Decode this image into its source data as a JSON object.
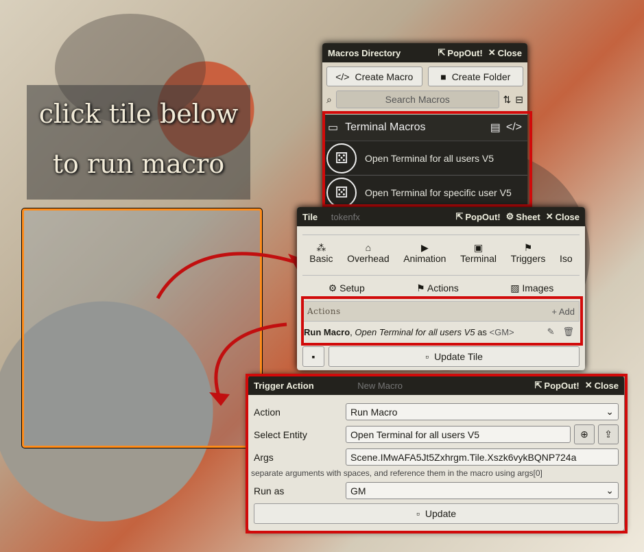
{
  "canvas": {
    "label_line1": "click tile below",
    "label_line2": "to run macro"
  },
  "macros_directory": {
    "title": "Macros Directory",
    "popout": "PopOut!",
    "close": "Close",
    "create_macro": "Create Macro",
    "create_folder": "Create Folder",
    "search_placeholder": "Search Macros",
    "folder_name": "Terminal Macros",
    "items": [
      {
        "label": "Open Terminal for all users V5"
      },
      {
        "label": "Open Terminal for specific user V5"
      }
    ],
    "hidden_items": [
      "tokenfx",
      "New Macro"
    ]
  },
  "tile_config": {
    "title": "Tile",
    "popout": "PopOut!",
    "sheet": "Sheet",
    "close": "Close",
    "tabs": [
      "Basic",
      "Overhead",
      "Animation",
      "Terminal",
      "Triggers",
      "Iso"
    ],
    "subtabs": [
      "Setup",
      "Actions",
      "Images"
    ],
    "actions_heading": "Actions",
    "add_label": "Add",
    "action_row": {
      "type": "Run Macro",
      "sep": ", ",
      "target": "Open Terminal for all users V5",
      "as_word": " as ",
      "runas": "<GM>"
    },
    "update_button": "Update Tile"
  },
  "trigger_action": {
    "title": "Trigger Action",
    "popout": "PopOut!",
    "close": "Close",
    "action_label": "Action",
    "action_value": "Run Macro",
    "entity_label": "Select Entity",
    "entity_value": "Open Terminal for all users V5",
    "args_label": "Args",
    "args_value": "Scene.IMwAFA5Jt5Zxhrgm.Tile.Xszk6vykBQNP724a",
    "hint": "separate arguments with spaces, and reference them in the macro using args[0]",
    "runas_label": "Run as",
    "runas_value": "GM",
    "update_button": "Update"
  },
  "colors": {
    "highlight": "#d10a0a",
    "tile_border": "#ff8c1a",
    "header_bg": "#23221d"
  }
}
